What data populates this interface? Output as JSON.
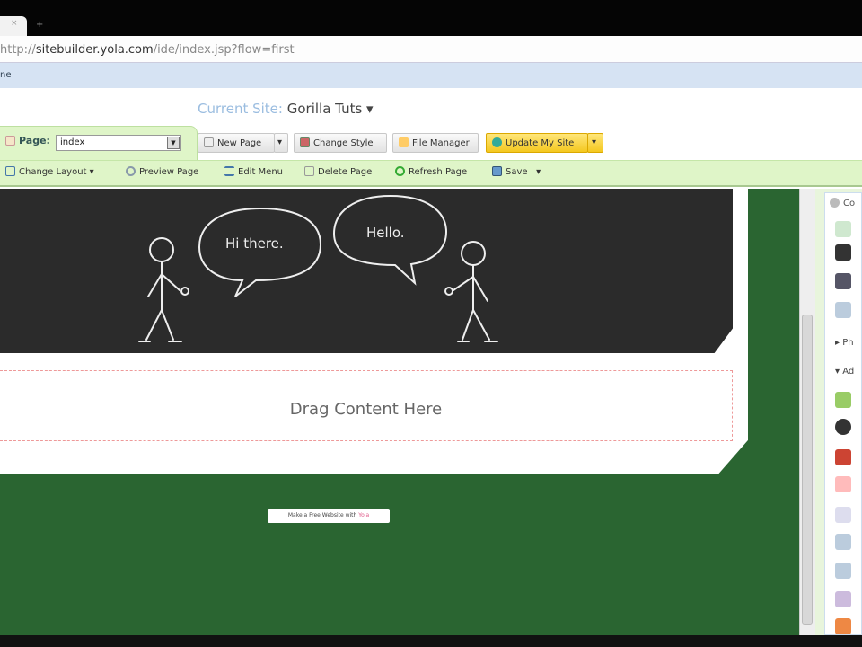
{
  "browser": {
    "tab_close": "×",
    "new_tab": "+",
    "url_prefix": "http://",
    "url_domain": "sitebuilder.yola.com",
    "url_path": "/ide/index.jsp?flow=first",
    "bookmark": "ne"
  },
  "header": {
    "current_site_label": "Current Site:",
    "current_site_value": "Gorilla Tuts ▾"
  },
  "page_selector": {
    "label": "Page:",
    "value": "index",
    "arrow": "▼"
  },
  "toolbar": {
    "new_page": "New Page",
    "dropdown": "▾",
    "change_style": "Change Style",
    "file_manager": "File Manager",
    "update_site": "Update My Site"
  },
  "toolbar2": {
    "change_layout": "Change Layout",
    "preview_page": "Preview Page",
    "edit_menu": "Edit Menu",
    "delete_page": "Delete Page",
    "refresh_page": "Refresh Page",
    "save": "Save",
    "caret": "▾"
  },
  "banner": {
    "bubble_left": "Hi there.",
    "bubble_right": "Hello."
  },
  "content": {
    "drop_zone": "Drag Content Here",
    "footer_prefix": "Make a Free Website with ",
    "footer_brand": "Yola"
  },
  "sidebar": {
    "header": "Co",
    "section1": "Ph",
    "section2": "Ad"
  }
}
